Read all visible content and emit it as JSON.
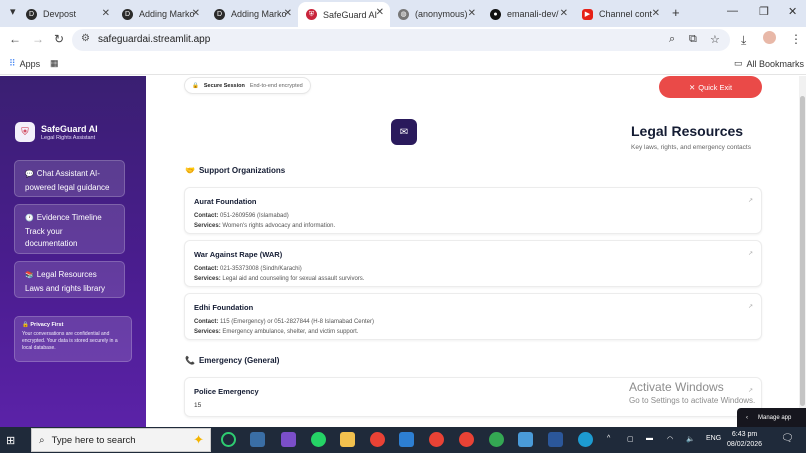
{
  "browser": {
    "tabs": [
      {
        "label": "Devpost",
        "active": false
      },
      {
        "label": "Adding Marko",
        "active": false
      },
      {
        "label": "Adding Marko",
        "active": false
      },
      {
        "label": "SafeGuard AI",
        "active": true
      },
      {
        "label": "(anonymous)",
        "active": false
      },
      {
        "label": "emanali-dev/",
        "active": false
      },
      {
        "label": "Channel cont",
        "active": false
      }
    ],
    "url": "safeguardai.streamlit.app",
    "bookmarks": {
      "apps": "Apps",
      "all": "All Bookmarks"
    }
  },
  "sidebar": {
    "brand_title": "SafeGuard AI",
    "brand_subtitle": "Legal Rights Assistant",
    "items": [
      {
        "label": "Chat Assistant AI-powered legal guidance"
      },
      {
        "label": "Evidence Timeline Track your documentation"
      },
      {
        "label": "Legal Resources Laws and rights library"
      }
    ],
    "privacy_title": "Privacy First",
    "privacy_body": "Your conversations are confidential and encrypted. Your data is stored securely in a local database."
  },
  "header": {
    "secure_label": "Secure Session",
    "secure_sub": "End-to-end encrypted",
    "quick_exit": "Quick Exit"
  },
  "page": {
    "title": "Legal Resources",
    "subtitle": "Key laws, rights, and emergency contacts"
  },
  "sections": {
    "support": "Support Organizations",
    "emergency": "Emergency (General)"
  },
  "labels": {
    "contact": "Contact:",
    "services": "Services:"
  },
  "organizations": [
    {
      "name": "Aurat Foundation",
      "contact": "051-2609596 (Islamabad)",
      "services": "Women's rights advocacy and information."
    },
    {
      "name": "War Against Rape (WAR)",
      "contact": "021-35373008 (Sindh/Karachi)",
      "services": "Legal aid and counseling for sexual assault survivors."
    },
    {
      "name": "Edhi Foundation",
      "contact": "115 (Emergency) or 051-2827844 (H-8 Islamabad Center)",
      "services": "Emergency ambulance, shelter, and victim support."
    }
  ],
  "emergency": [
    {
      "name": "Police Emergency",
      "value": "15"
    }
  ],
  "watermark": {
    "line1": "Activate Windows",
    "line2": "Go to Settings to activate Windows."
  },
  "manage_app": "Manage app",
  "taskbar": {
    "search_placeholder": "Type here to search",
    "lang": "ENG",
    "time": "6:43 pm",
    "date": "08/02/2026"
  },
  "colors": {
    "sidebar": "#4a1d8f",
    "quick_exit": "#ea4a48",
    "accent_dark": "#2a1a5c"
  }
}
